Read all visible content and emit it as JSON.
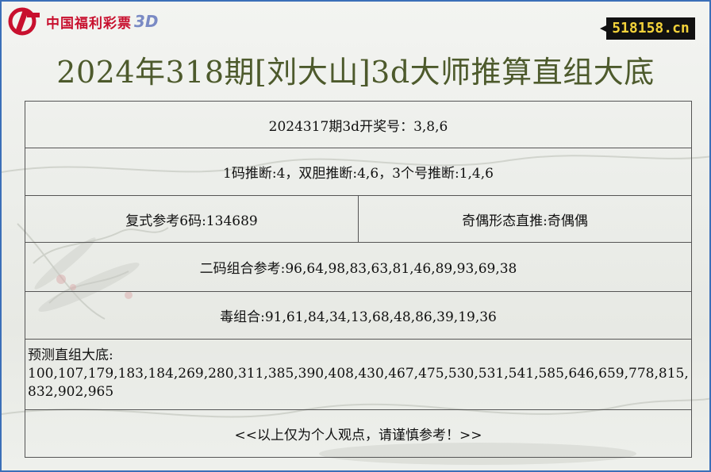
{
  "header": {
    "logo_text": "中国福利彩票",
    "logo_3d": "3D",
    "site_badge": "518158.cn"
  },
  "title": "2024年318期[刘大山]3d大师推算直组大底",
  "rows": {
    "draw_result": "2024317期3d开奖号：3,8,6",
    "code_analysis": "1码推断:4，双胆推断:4,6，3个号推断:1,4,6",
    "compound_ref": "复式参考6码:134689",
    "odd_even": "奇偶形态直推:奇偶偶",
    "two_code": "二码组合参考:96,64,98,83,63,81,46,89,93,69,38",
    "poison": "毒组合:91,61,84,34,13,68,48,86,39,19,36",
    "prediction_label": "预测直组大底:",
    "prediction_list": "100,107,179,183,184,269,280,311,385,390,408,430,467,475,530,531,541,585,646,659,778,815,832,902,965",
    "disclaimer": "<<以上仅为个人观点，请谨慎参考！>>"
  },
  "colors": {
    "border": "#3b6fb8",
    "title": "#4d5a2c",
    "logo_red": "#c8102e",
    "badge_bg": "#111111",
    "badge_text": "#f3d23a"
  }
}
